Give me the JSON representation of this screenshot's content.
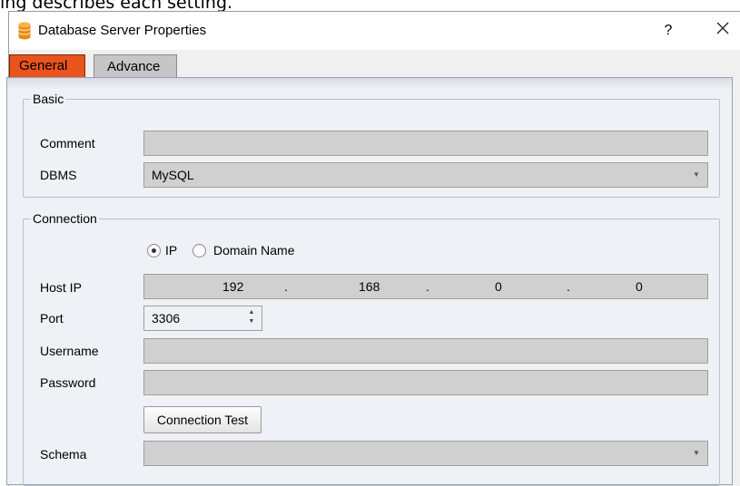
{
  "page_text": "ing describes each setting.",
  "window": {
    "title": "Database Server Properties",
    "help_glyph": "?",
    "app_icon": "database-icon",
    "close_icon": "close-icon"
  },
  "tabs": [
    {
      "label": "General",
      "active": true,
      "color": "#e8541c"
    },
    {
      "label": "Advance",
      "active": false
    }
  ],
  "basic": {
    "title": "Basic",
    "comment_label": "Comment",
    "comment_value": "",
    "dbms_label": "DBMS",
    "dbms_value": "MySQL"
  },
  "connection": {
    "title": "Connection",
    "mode_options": [
      {
        "label": "IP",
        "selected": true
      },
      {
        "label": "Domain Name",
        "selected": false
      }
    ],
    "host_ip_label": "Host IP",
    "host_ip": [
      "192",
      "168",
      "0",
      "0"
    ],
    "ip_separator": ".",
    "port_label": "Port",
    "port_value": "3306",
    "username_label": "Username",
    "username_value": "",
    "password_label": "Password",
    "password_value": "",
    "test_button": "Connection Test",
    "schema_label": "Schema",
    "schema_value": ""
  }
}
